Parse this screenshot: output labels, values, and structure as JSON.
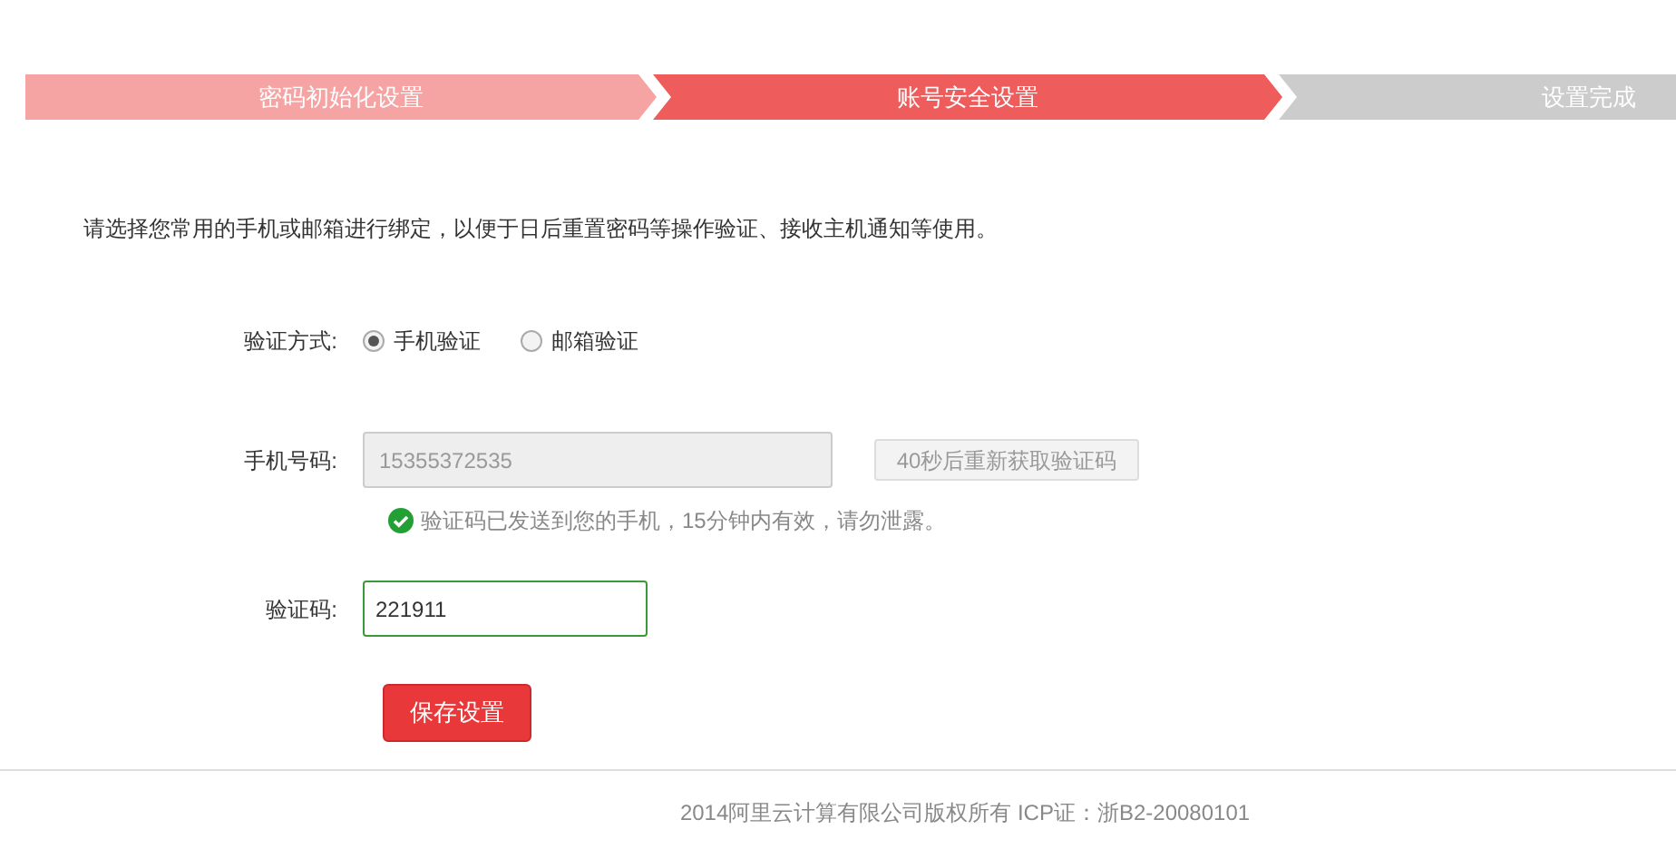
{
  "steps": [
    {
      "label": "密码初始化设置",
      "kind": "done"
    },
    {
      "label": "账号安全设置",
      "kind": "current"
    },
    {
      "label": "设置完成",
      "kind": "pending"
    }
  ],
  "intro": "请选择您常用的手机或邮箱进行绑定，以便于日后重置密码等操作验证、接收主机通知等使用。",
  "method": {
    "label": "验证方式:",
    "options": [
      {
        "label": "手机验证",
        "selected": true
      },
      {
        "label": "邮箱验证",
        "selected": false
      }
    ]
  },
  "phone": {
    "label": "手机号码:",
    "value": "15355372535",
    "disabled": true,
    "resend_button": "40秒后重新获取验证码",
    "hint": "验证码已发送到您的手机，15分钟内有效，请勿泄露。"
  },
  "code": {
    "label": "验证码:",
    "value": "221911"
  },
  "save_button": "保存设置",
  "footer": "2014阿里云计算有限公司版权所有 ICP证：浙B2-20080101"
}
